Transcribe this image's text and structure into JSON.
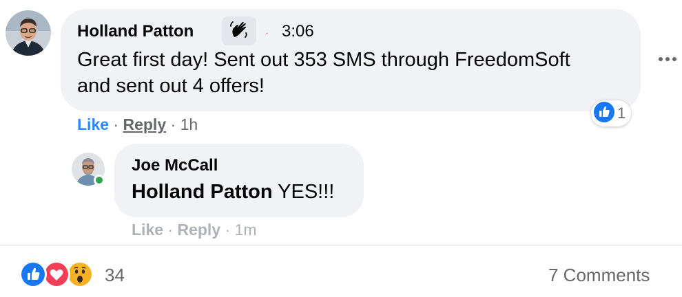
{
  "comment": {
    "author": "Holland Patton",
    "badge_icon": "waving-hand-icon",
    "time": "3:06",
    "text": "Great first day! Sent out 353 SMS through FreedomSoft and sent out 4 offers!",
    "reaction_count": "1",
    "actions": {
      "like": "Like",
      "reply": "Reply",
      "age": "1h"
    }
  },
  "reply": {
    "author": "Joe McCall",
    "mention": "Holland Patton",
    "text": " YES!!!",
    "actions": {
      "like": "Like",
      "reply": "Reply",
      "age": "1m"
    }
  },
  "post_footer": {
    "reactions": [
      "like-icon",
      "love-icon",
      "wow-icon"
    ],
    "reaction_total": "34",
    "comments_label": "7 Comments"
  },
  "colors": {
    "bubble": "#f0f2f5",
    "like_blue": "#2d88ff",
    "secondary_text": "#65676b",
    "online": "#31a24c"
  }
}
